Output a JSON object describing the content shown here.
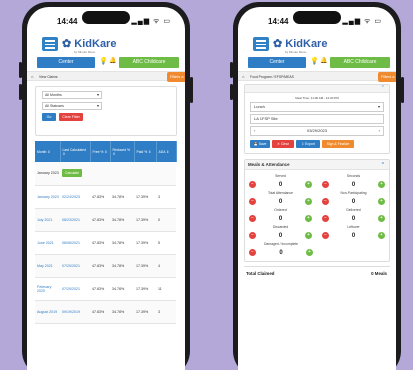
{
  "left": {
    "time": "14:44",
    "center_label": "Center",
    "site_label": "ABC Childcare",
    "breadcrumb": "View Claims",
    "filters_label": "Filters a",
    "month_select": "All Months",
    "status_select": "All Statuses",
    "go_label": "Go",
    "clear_label": "Clear Filter",
    "columns": [
      "Month",
      "Last Calculated",
      "Free %",
      "Reduced %",
      "Paid %",
      "ADA"
    ],
    "rows": [
      {
        "month": "January 2023",
        "calc": "",
        "free": "",
        "reduced": "",
        "paid": "",
        "ada": "",
        "action": "Calculate"
      },
      {
        "month": "January 2023",
        "calc": "02/24/2023",
        "free": "47.83%",
        "reduced": "34.78%",
        "paid": "17.39%",
        "ada": "3"
      },
      {
        "month": "July 2021",
        "calc": "08/23/2021",
        "free": "47.83%",
        "reduced": "34.78%",
        "paid": "17.39%",
        "ada": "0"
      },
      {
        "month": "June 2021",
        "calc": "08/06/2021",
        "free": "47.83%",
        "reduced": "34.78%",
        "paid": "17.39%",
        "ada": "5"
      },
      {
        "month": "May 2021",
        "calc": "07/20/2021",
        "free": "47.83%",
        "reduced": "34.78%",
        "paid": "17.39%",
        "ada": "4"
      },
      {
        "month": "February 2020",
        "calc": "07/20/2021",
        "free": "47.83%",
        "reduced": "34.78%",
        "paid": "17.39%",
        "ada": "11"
      },
      {
        "month": "August 2019",
        "calc": "09/19/2019",
        "free": "47.83%",
        "reduced": "34.78%",
        "paid": "17.39%",
        "ada": "3"
      }
    ]
  },
  "right": {
    "time": "14:44",
    "center_label": "Center",
    "site_label": "ABC Childcare",
    "breadcrumb": "Food Program  /  EFSP/MEAS",
    "filters_label": "Filters a",
    "meal_time": "Meal Time: 11:00 AM - 12:00 PM",
    "meal_select": "Lunch",
    "meal_field": "LA 1FSP Site",
    "date": "03/29/2023",
    "actions": {
      "save": "Save",
      "clear": "Clear",
      "export": "Export",
      "sign": "Sign & Finalize"
    },
    "ma_title": "Meals & Attendance",
    "stats": [
      {
        "label": "Served",
        "value": "0"
      },
      {
        "label": "Seconds",
        "value": "0"
      },
      {
        "label": "Total Attendance",
        "value": "0"
      },
      {
        "label": "Non-Participating",
        "value": "0"
      },
      {
        "label": "Ordered",
        "value": "0"
      },
      {
        "label": "Delivered",
        "value": "0"
      },
      {
        "label": "Discarded",
        "value": "0"
      },
      {
        "label": "Leftover",
        "value": "0"
      }
    ],
    "damaged": {
      "label": "Damaged / Incomplete",
      "value": "0"
    },
    "total_label": "Total Claimed",
    "total_value": "0 Meals"
  },
  "colors": {
    "blue": "#2f7dc4",
    "green": "#6ebc45",
    "red": "#e3423f",
    "orange": "#f08a2f",
    "background": "#b3a8d8"
  },
  "icons": [
    "hamburger-menu-icon",
    "bulb-icon",
    "bell-icon",
    "home-icon",
    "chevron-up-icon",
    "sort-icon"
  ]
}
